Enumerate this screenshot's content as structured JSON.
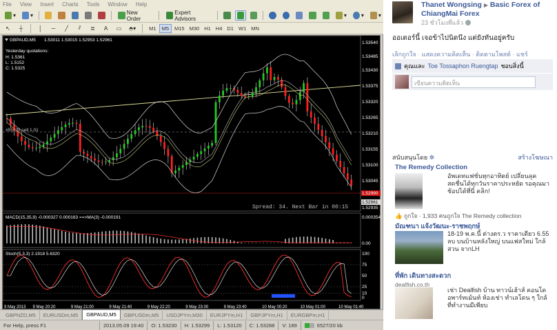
{
  "mt4": {
    "menu": [
      "File",
      "View",
      "Insert",
      "Charts",
      "Tools",
      "Window",
      "Help"
    ],
    "toolbar": {
      "new_order": "New Order",
      "expert_advisors": "Expert Advisors"
    },
    "timeframes": [
      "M1",
      "M5",
      "M15",
      "M30",
      "H1",
      "H4",
      "D1",
      "W1",
      "MN"
    ],
    "active_timeframe": "M5",
    "chart": {
      "symbol_label": "GBPAUD,M5",
      "ohlc_header": "1.53011 1.53015 1.52953 1.52961",
      "yesterday_title": "Yesterday quotations:",
      "yesterday": [
        "H: 1.5361",
        "L: 1.5152",
        "C: 1.5325"
      ],
      "spread_text": "Spread: 34. Next Bar in 00:15",
      "hline_label": "#55073 sell 1.01",
      "price_ticks": [
        "1.53540",
        "1.53485",
        "1.53430",
        "1.53375",
        "1.53320",
        "1.53265",
        "1.53210",
        "1.53155",
        "1.53100",
        "1.53045",
        "1.52990",
        "1.52961",
        "1.52935"
      ],
      "current_price": "1.52990",
      "bid_price": "1.52961",
      "macd_label": "MACD(15,35,9) -0.000327 0.000163 ==>MA(3) -0.000191",
      "macd_ticks": [
        "0.000354",
        "0.00"
      ],
      "stoch_label": "Stoch(5,3,3) 2.1918 5.6320",
      "stoch_ticks": [
        "100",
        "75",
        "50",
        "25",
        "10",
        "0"
      ],
      "time_ticks": [
        "9 May 2013",
        "9 May 20:20",
        "9 May 21:00",
        "9 May 21:40",
        "9 May 22:20",
        "9 May 23:00",
        "9 May 23:40",
        "10 May 00:20",
        "10 May 01:00",
        "10 May 01:40"
      ],
      "colors": {
        "bull": "#22cc22",
        "bear": "#ff2020",
        "bands": "#c0c0c0",
        "trend": "#e8e8a0",
        "stoch_main": "#ff3030",
        "stoch_signal": "#ffffff",
        "macd_hist": "#c0c0c0",
        "grid": "#444444"
      }
    },
    "tabs": [
      "GBPNZD,M5",
      "EURUSDm,M5",
      "GBPAUD,M5",
      "GBPUSDm,M5",
      "USDJPYm,M30",
      "EURJPYm,H1",
      "GBPJPYm,H1",
      "EURGBPm,H1"
    ],
    "active_tab": "GBPAUD,M5",
    "status": [
      "For Help, press F1",
      "2013.05.09 19:40",
      "O: 1.53230",
      "H: 1.53299",
      "L: 1.53120",
      "C: 1.53288",
      "V: 189",
      "6527/20 kb"
    ]
  },
  "facebook": {
    "author": "Thanet Wongsing",
    "page": "Basic Forex of ChiangMai Forex",
    "time": "23 ชั่วโมงที่แล้ว",
    "message": "ออเดอร์นี้ เจอข้าไปนิดนึง แต่ยังทันอยู่ครับ",
    "actions": [
      "เลิกถูกใจ",
      "แสดงความคิดเห็น",
      "ติดตามโพสต์",
      "แชร์"
    ],
    "likes_prefix": "คุณและ",
    "likes_name": "Toe Tossaphon Ruengtap",
    "likes_suffix": "ชอบสิ่งนี้",
    "comment_placeholder": "เขียนความคิดเห็น",
    "ads_heading": "สนับสนุนโดย",
    "ads_create": "สร้างโฆษณา",
    "ads": [
      {
        "title": "The Remedy Collection",
        "text": "อัพเดทแฟชั่นทุกอาทิตย์ เปลี่ยนลุคสดชื่นได้ทุกวันราคาประหยัด รอคุณมาช้อปได้ที่นี่ คลิก!",
        "like": "ถูกใจ · 1,933 คนถูกใจ The Remedy collection"
      },
      {
        "title": "มัณฑนา แจ้งวัฒนะ-ราชพฤกษ์",
        "text": "18-19 พ.ค.นี้ ต่างตร.ว ราคาเดียว 6.55 ลบ บนบ้านหลังใหญ่ บนแฟสใหม่ ใกล้สวน จากLH"
      },
      {
        "title": "ที่พัก เดินทางสะดวก",
        "sub": "dealfish.co.th",
        "text": "เช่า Dealfish บ้าน ทาวน์เฮ้าส์ คอนโด อพาร์ทเม้นท์ ห้องเช่า ทำเลโดน ๆ ใกล้ที่ทำงานมีเพียบ"
      }
    ]
  }
}
